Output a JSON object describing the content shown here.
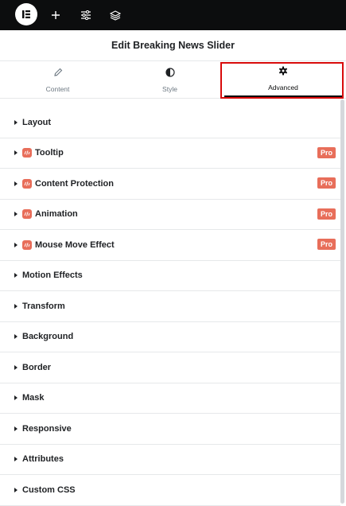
{
  "topbar": {
    "logo_icon": "elementor-logo-icon",
    "add_icon": "plus-icon",
    "settings_icon": "sliders-icon",
    "structure_icon": "layers-icon"
  },
  "header": {
    "title": "Edit Breaking News Slider"
  },
  "tabs": [
    {
      "label": "Content",
      "icon": "pencil-icon"
    },
    {
      "label": "Style",
      "icon": "half-circle-icon"
    },
    {
      "label": "Advanced",
      "icon": "gear-icon",
      "active": true
    }
  ],
  "sections": [
    {
      "label": "Layout",
      "pro": false
    },
    {
      "label": "Tooltip",
      "pro": true,
      "badge": "Pro"
    },
    {
      "label": "Content Protection",
      "pro": true,
      "badge": "Pro"
    },
    {
      "label": "Animation",
      "pro": true,
      "badge": "Pro"
    },
    {
      "label": "Mouse Move Effect",
      "pro": true,
      "badge": "Pro"
    },
    {
      "label": "Motion Effects",
      "pro": false
    },
    {
      "label": "Transform",
      "pro": false
    },
    {
      "label": "Background",
      "pro": false
    },
    {
      "label": "Border",
      "pro": false
    },
    {
      "label": "Mask",
      "pro": false
    },
    {
      "label": "Responsive",
      "pro": false
    },
    {
      "label": "Attributes",
      "pro": false
    },
    {
      "label": "Custom CSS",
      "pro": false
    }
  ],
  "colors": {
    "topbar_bg": "#0c0d0e",
    "pro_accent": "#e86e5a",
    "highlight": "#d80b0b",
    "divider": "#e6e8ea"
  }
}
